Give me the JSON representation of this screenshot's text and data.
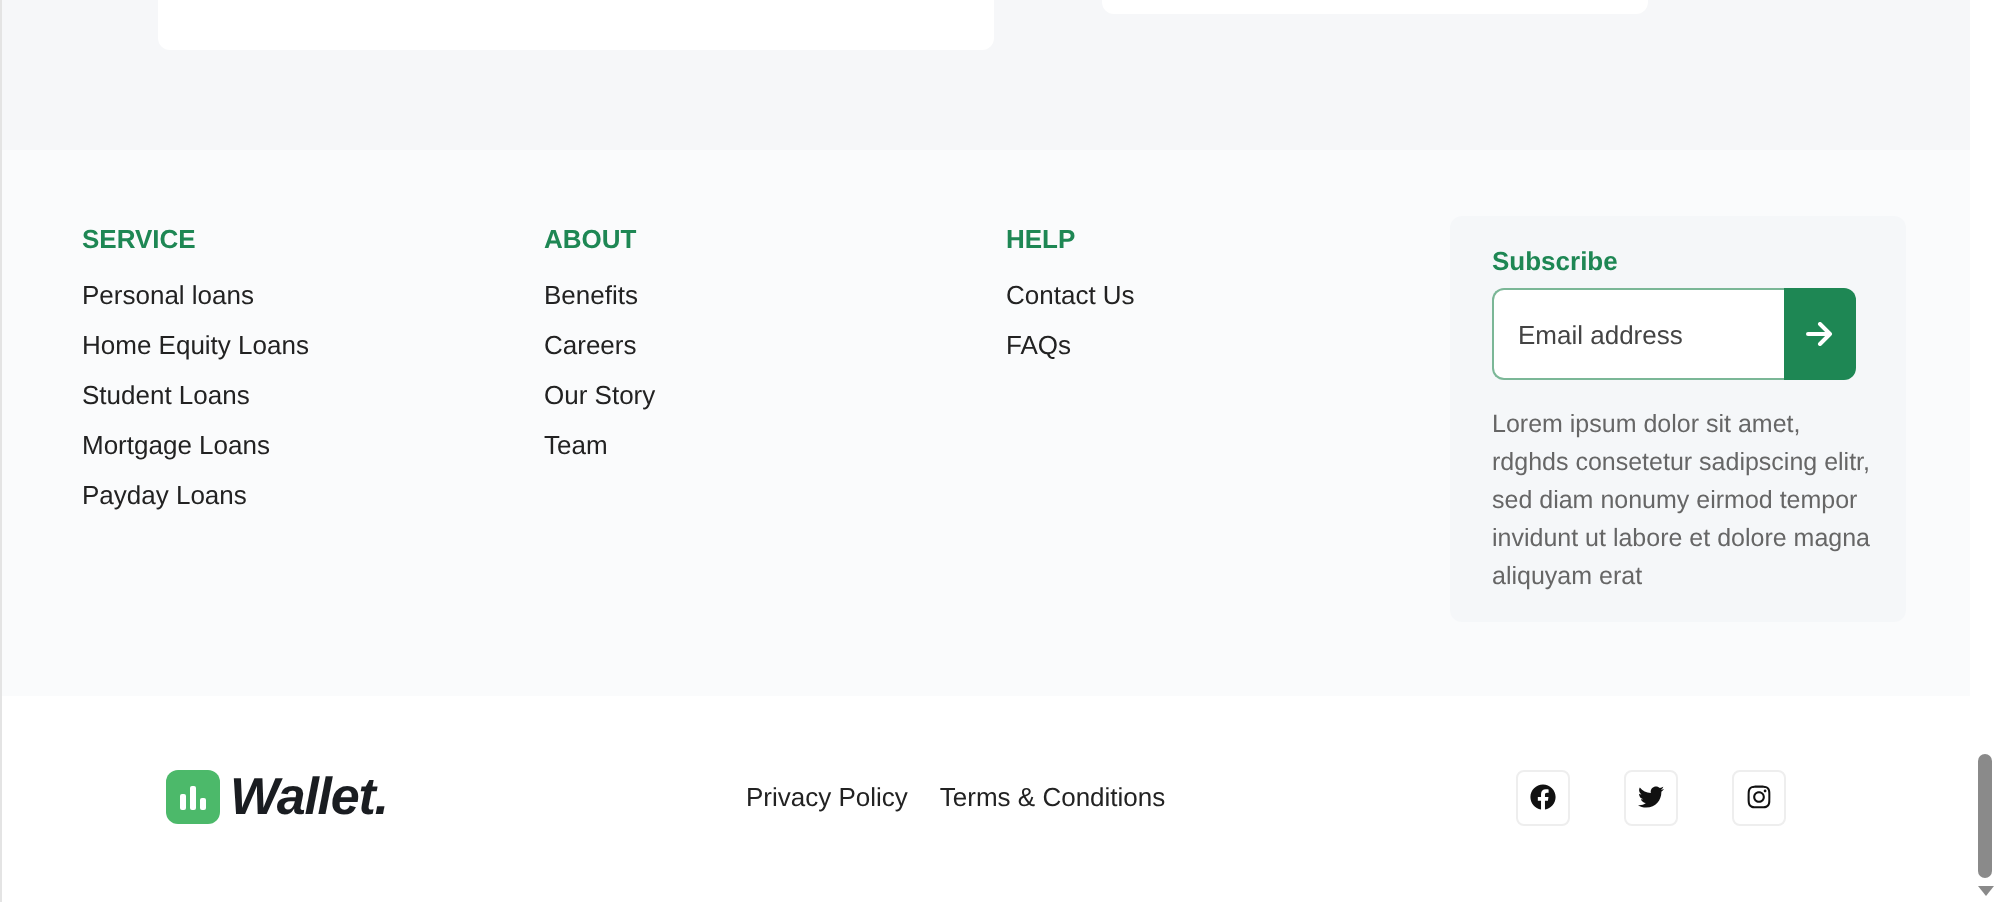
{
  "columns": [
    {
      "title": "SERVICE",
      "links": [
        "Personal loans",
        "Home Equity Loans",
        "Student Loans",
        "Mortgage Loans",
        "Payday Loans"
      ]
    },
    {
      "title": "ABOUT",
      "links": [
        "Benefits",
        "Careers",
        "Our Story",
        "Team"
      ]
    },
    {
      "title": "HELP",
      "links": [
        "Contact Us",
        "FAQs"
      ]
    }
  ],
  "subscribe": {
    "title": "Subscribe",
    "placeholder": "Email address",
    "text": "Lorem ipsum dolor sit amet, rdghds consetetur sadipscing elitr, sed diam nonumy eirmod tempor invidunt ut labore et dolore magna aliquyam erat"
  },
  "brand": "Wallet.",
  "legal_links": [
    "Privacy Policy",
    "Terms & Conditions"
  ],
  "social": [
    {
      "kind": "facebook"
    },
    {
      "kind": "twitter"
    },
    {
      "kind": "instagram"
    }
  ]
}
